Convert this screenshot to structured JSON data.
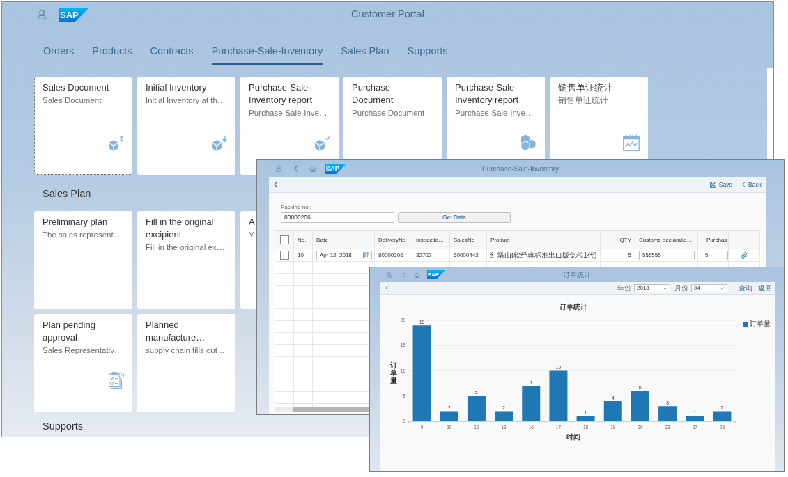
{
  "portal": {
    "logo": "SAP",
    "title": "Customer Portal",
    "tabs": [
      {
        "label": "Orders",
        "selected": false
      },
      {
        "label": "Products",
        "selected": false
      },
      {
        "label": "Contracts",
        "selected": false
      },
      {
        "label": "Purchase-Sale-Inventory",
        "selected": true
      },
      {
        "label": "Sales Plan",
        "selected": false
      },
      {
        "label": "Supports",
        "selected": false
      }
    ],
    "tiles": [
      {
        "title": "Sales Document",
        "subtitle": "Sales Document",
        "focused": true
      },
      {
        "title": "Initial Inventory",
        "subtitle": "Initial Inventory at th…",
        "focused": false
      },
      {
        "title": "Purchase-Sale-Inventory report",
        "subtitle": "Purchase-Sale-Inve…",
        "focused": false
      },
      {
        "title": "Purchase Document",
        "subtitle": "Purchase Document",
        "focused": false
      },
      {
        "title": "Purchase-Sale-Inventory report",
        "subtitle": "Purchase-Sale-Inve…",
        "focused": false
      },
      {
        "title": "销售单证统计",
        "subtitle": "销售单证统计",
        "focused": false
      }
    ],
    "sections": [
      {
        "title": "Sales Plan",
        "tile_rows": [
          {
            "tiles": [
              {
                "title": "Preliminary plan",
                "subtitle": "The sales represent…",
                "focused": false
              },
              {
                "title": "Fill in the original excipient",
                "subtitle": "Fill in the original ex…",
                "focused": false
              },
              {
                "title": "A",
                "subtitle": "Y",
                "focused": false
              }
            ]
          },
          {
            "tiles": [
              {
                "title": "Plan pending approval",
                "subtitle": "Sales Representativ…",
                "focused": false
              },
              {
                "title": "Planned manufacture…",
                "subtitle": "supply chain fills out …",
                "focused": false
              }
            ]
          }
        ]
      },
      {
        "title": "Supports"
      }
    ]
  },
  "inventory_window": {
    "logo": "SAP",
    "title": "Purchase-Sale-Inventory",
    "save": "Save",
    "back": "Back",
    "packing": {
      "label": "Packing no.:",
      "value": "80000206"
    },
    "get_data": "Get Data",
    "table": {
      "select_all_checked": false,
      "columns": [
        {
          "label": "No.",
          "kind": "text"
        },
        {
          "label": "Date",
          "kind": "date"
        },
        {
          "label": "DeliveryNo",
          "kind": "text"
        },
        {
          "label": "Inspectio…",
          "kind": "text"
        },
        {
          "label": "SalesNo",
          "kind": "text"
        },
        {
          "label": "Product",
          "kind": "text"
        },
        {
          "label": "QTY",
          "kind": "number"
        },
        {
          "label": "Customs declaratio…",
          "kind": "input"
        },
        {
          "label": "Purchas",
          "kind": "input"
        }
      ],
      "rows": [
        {
          "checked": false,
          "cells": [
            "10",
            "Apr 12, 2018",
            "80000206",
            "32702",
            "60000442",
            "红塔山(软经典标准出口版免税1代)",
            "5",
            "555555",
            "5"
          ]
        }
      ]
    }
  },
  "stats_window": {
    "logo": "SAP",
    "title": "订单统计",
    "year": {
      "label": "年份",
      "value": "2018"
    },
    "month": {
      "label": "月份",
      "value": "04"
    },
    "query": "查询",
    "back": "返回",
    "chart_data": {
      "type": "bar",
      "title": "订单统计",
      "xlabel": "时间",
      "ylabel": "订单量",
      "categories": [
        "9",
        "10",
        "12",
        "13",
        "16",
        "17",
        "18",
        "19",
        "20",
        "23",
        "27",
        "28"
      ],
      "series": [
        {
          "name": "订单量",
          "color": "#1f77b4",
          "values": [
            19,
            2,
            5,
            2,
            7,
            10,
            1,
            4,
            6,
            3,
            1,
            2
          ]
        }
      ],
      "ylim": [
        0,
        20
      ],
      "yticks": [
        0,
        5,
        10,
        15,
        20
      ],
      "grid": true,
      "data_labels": true
    }
  }
}
